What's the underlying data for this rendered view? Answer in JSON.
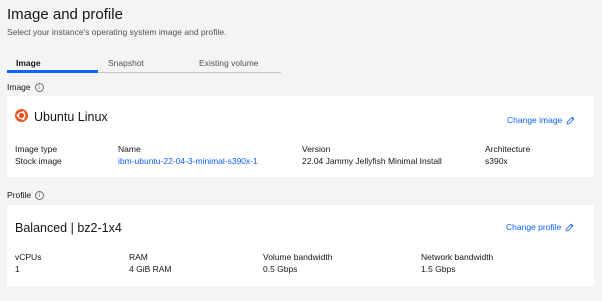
{
  "header": {
    "title": "Image and profile",
    "description": "Select your instance's operating system image and profile."
  },
  "tabs": [
    {
      "label": "Image",
      "active": true
    },
    {
      "label": "Snapshot",
      "active": false
    },
    {
      "label": "Existing volume",
      "active": false
    }
  ],
  "image_section": {
    "label": "Image",
    "card": {
      "title": "Ubuntu Linux",
      "icon": "ubuntu-logo-icon",
      "change_label": "Change image",
      "fields": [
        {
          "label": "Image type",
          "value": "Stock image",
          "is_link": false
        },
        {
          "label": "Name",
          "value": "ibm-ubuntu-22-04-3-minimal-s390x-1",
          "is_link": true
        },
        {
          "label": "Version",
          "value": "22.04 Jammy Jellyfish Minimal Install",
          "is_link": false
        },
        {
          "label": "Architecture",
          "value": "s390x",
          "is_link": false
        }
      ]
    }
  },
  "profile_section": {
    "label": "Profile",
    "card": {
      "title": "Balanced | bz2-1x4",
      "change_label": "Change profile",
      "fields": [
        {
          "label": "vCPUs",
          "value": "1"
        },
        {
          "label": "RAM",
          "value": "4 GiB RAM"
        },
        {
          "label": "Volume bandwidth",
          "value": "0.5 Gbps"
        },
        {
          "label": "Network bandwidth",
          "value": "1.5 Gbps"
        }
      ]
    }
  },
  "colors": {
    "accent": "#0f62fe",
    "ubuntu_orange": "#e95420",
    "background": "#f4f4f4",
    "card": "#ffffff"
  }
}
